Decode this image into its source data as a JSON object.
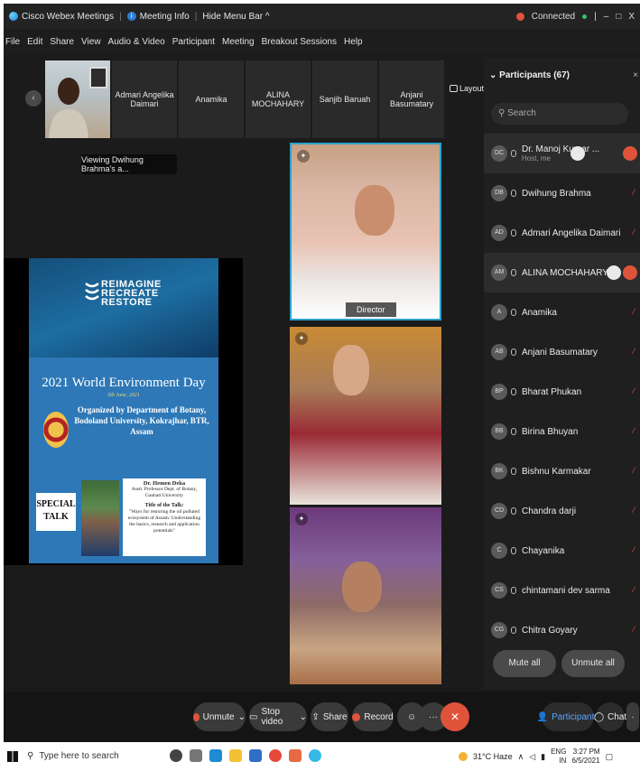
{
  "titlebar": {
    "app": "Cisco Webex Meetings",
    "meeting_info": "Meeting Info",
    "hide_menu": "Hide Menu Bar ^",
    "status": "Connected",
    "controls": [
      "|",
      "–",
      "□",
      "X"
    ]
  },
  "menu": [
    "File",
    "Edit",
    "Share",
    "View",
    "Audio & Video",
    "Participant",
    "Meeting",
    "Breakout Sessions",
    "Help"
  ],
  "strip": {
    "thumbs": [
      "Admari Angelika Daimari",
      "Anamika",
      "ALINA MOCHAHARY",
      "Sanjib Baruah",
      "Anjani Basumatary"
    ],
    "layout_label": "Layout"
  },
  "stage": {
    "viewing_label": "Viewing Dwihung Brahma's a...",
    "poster": {
      "brand": [
        "REIMAGINE",
        "RECREATE",
        "RESTORE"
      ],
      "title": "2021 World Environment Day",
      "date": "5th June, 2021",
      "organized": "Organized by Department of Botany, Bodoland University, Kokrajhar, BTR, Assam",
      "special_talk": "SPECIAL TALK",
      "speaker": "Dr. Hemen Deka",
      "speaker_role": "Asstt. Professor Dept. of Botany, Gauhati University",
      "talk_heading": "Title of the Talk:",
      "talk_title": "\"Ways for restoring the oil polluted ecosystem of Assam: Understanding the basics, research and application potentials\""
    },
    "video1_name": "Director"
  },
  "controls": {
    "unmute": "Unmute",
    "stop_video": "Stop video",
    "share": "Share",
    "record": "Record",
    "participants": "Participants",
    "chat": "Chat"
  },
  "panel": {
    "title": "Participants (67)",
    "search_placeholder": "Search",
    "participants": [
      {
        "initials": "DC",
        "name": "Dr. Manoj Kumar ...",
        "sub": "Host, me"
      },
      {
        "initials": "DB",
        "name": "Dwihung Brahma",
        "sub": ""
      },
      {
        "initials": "AD",
        "name": "Admari Angelika Daimari",
        "sub": ""
      },
      {
        "initials": "AM",
        "name": "ALINA MOCHAHARY",
        "sub": ""
      },
      {
        "initials": "A",
        "name": "Anamika",
        "sub": ""
      },
      {
        "initials": "AB",
        "name": "Anjani Basumatary",
        "sub": ""
      },
      {
        "initials": "BP",
        "name": "Bharat Phukan",
        "sub": ""
      },
      {
        "initials": "BB",
        "name": "Birina Bhuyan",
        "sub": ""
      },
      {
        "initials": "BK",
        "name": "Bishnu Karmakar",
        "sub": ""
      },
      {
        "initials": "CD",
        "name": "Chandra darji",
        "sub": ""
      },
      {
        "initials": "C",
        "name": "Chayanika",
        "sub": ""
      },
      {
        "initials": "CS",
        "name": "chintamani dev sarma",
        "sub": ""
      },
      {
        "initials": "CG",
        "name": "Chitra Goyary",
        "sub": ""
      }
    ],
    "mute_all": "Mute all",
    "unmute_all": "Unmute all"
  },
  "taskbar": {
    "search": "Type here to search",
    "weather": "31°C Haze",
    "lang": "ENG",
    "region": "IN",
    "time": "3:27 PM",
    "date": "6/5/2021"
  }
}
